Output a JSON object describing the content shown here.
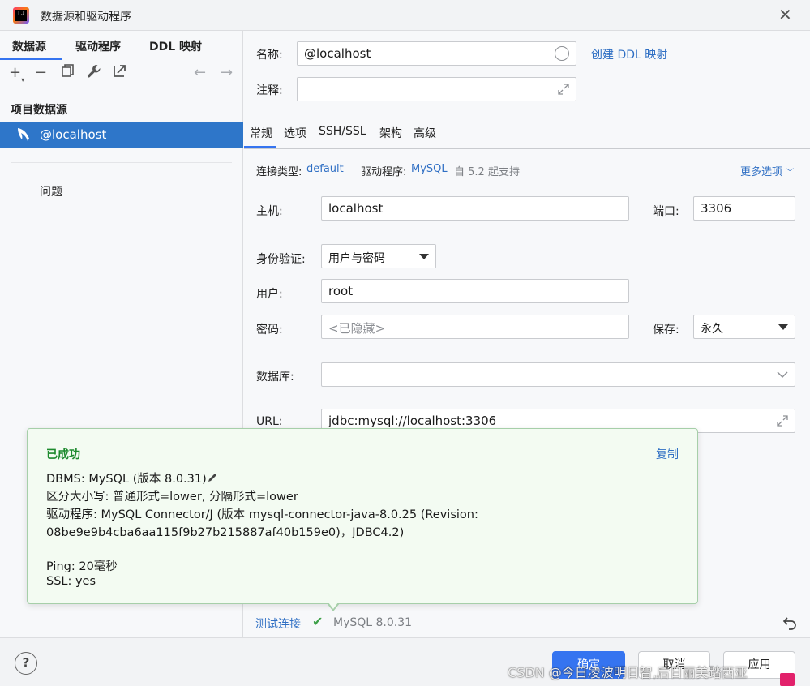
{
  "window": {
    "title": "数据源和驱动程序",
    "app_icon_text": "IJ"
  },
  "sidebar": {
    "tabs": [
      {
        "label": "数据源"
      },
      {
        "label": "驱动程序"
      },
      {
        "label": "DDL 映射"
      }
    ],
    "toolbar": {
      "add": "+",
      "remove": "−"
    },
    "section_title": "项目数据源",
    "datasources": [
      {
        "label": "@localhost"
      }
    ],
    "problems_label": "问题"
  },
  "main": {
    "name_label": "名称:",
    "name_value": "@localhost",
    "create_ddl_link": "创建 DDL 映射",
    "comment_label": "注释:",
    "comment_value": "",
    "tabs": [
      {
        "label": "常规"
      },
      {
        "label": "选项"
      },
      {
        "label": "SSH/SSL"
      },
      {
        "label": "架构"
      },
      {
        "label": "高级"
      }
    ],
    "connection_type_label": "连接类型:",
    "connection_type_value": "default",
    "driver_label": "驱动程序:",
    "driver_value": "MySQL",
    "driver_note": "自 5.2 起支持",
    "more_options": "更多选项",
    "host_label": "主机:",
    "host_value": "localhost",
    "port_label": "端口:",
    "port_value": "3306",
    "auth_label": "身份验证:",
    "auth_value": "用户与密码",
    "user_label": "用户:",
    "user_value": "root",
    "password_label": "密码:",
    "password_placeholder": "<已隐藏>",
    "save_label": "保存:",
    "save_value": "永久",
    "database_label": "数据库:",
    "database_value": "",
    "url_label": "URL:",
    "url_value": "jdbc:mysql://localhost:3306",
    "test_connection": "测试连接",
    "test_result": "MySQL 8.0.31",
    "check_mark": "✔"
  },
  "popup": {
    "title": "已成功",
    "copy": "复制",
    "lines": [
      "DBMS: MySQL (版本 8.0.31)",
      "区分大小写: 普通形式=lower, 分隔形式=lower",
      "驱动程序: MySQL Connector/J (版本 mysql-connector-java-8.0.25 (Revision:",
      "08be9e9b4cba6aa115f9b27b215887af40b159e0)，JDBC4.2)",
      "Ping: 20毫秒",
      "SSL: yes"
    ]
  },
  "footer": {
    "help": "?",
    "ok": "确定",
    "cancel": "取消",
    "apply": "应用"
  },
  "watermark": "CSDN @今日凌波明日智,后日丽美踏西亚",
  "colors": {
    "accent": "#3574f0",
    "selection": "#2e76c9",
    "link": "#2f6fc4",
    "success": "#1d8a2e"
  }
}
